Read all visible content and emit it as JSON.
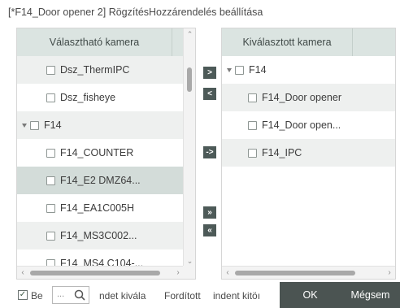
{
  "dialog": {
    "title": "[*F14_Door opener 2] RögzítésHozzárendelés beállítása"
  },
  "left_panel": {
    "header": "Választható kamera",
    "rows": [
      {
        "label": "Dsz_ThermIPC",
        "type": "camera"
      },
      {
        "label": "Dsz_fisheye",
        "type": "camera"
      },
      {
        "label": "F14",
        "type": "group"
      },
      {
        "label": "F14_COUNTER",
        "type": "camera"
      },
      {
        "label": "F14_E2 DMZ64...",
        "type": "camera"
      },
      {
        "label": "F14_EA1C005H",
        "type": "camera"
      },
      {
        "label": "F14_MS3C002...",
        "type": "camera"
      },
      {
        "label": "F14_MS4 C104-...",
        "type": "camera"
      }
    ]
  },
  "right_panel": {
    "header": "Kiválasztott kamera",
    "rows": [
      {
        "label": "F14",
        "type": "group"
      },
      {
        "label": "F14_Door opener",
        "type": "camera"
      },
      {
        "label": "F14_Door open...",
        "type": "camera"
      },
      {
        "label": "F14_IPC",
        "type": "camera"
      }
    ]
  },
  "transfer_buttons": {
    "add": ">",
    "remove": "<",
    "add_selected": "->",
    "add_all": "»",
    "remove_all": "«"
  },
  "footer": {
    "checkbox_label": "Be",
    "checkbox_checked": true,
    "search_placeholder": "...",
    "text_1": "ndet kivála",
    "text_2": "Fordított",
    "text_3": "indent kitöı",
    "ok_label": "OK",
    "cancel_label": "Mégsem"
  },
  "icons": {
    "search": "search-icon",
    "checkbox": "checkbox-icon",
    "expand": "expand-triangle-icon"
  },
  "colors": {
    "header_bg": "#dbe4e1",
    "selected_row_bg": "#d3dcd9",
    "button_bg": "#4b5452"
  }
}
